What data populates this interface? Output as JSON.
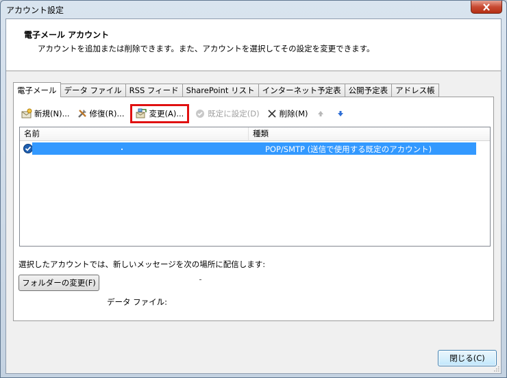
{
  "window": {
    "title": "アカウント設定"
  },
  "header": {
    "title": "電子メール アカウント",
    "description": "アカウントを追加または削除できます。また、アカウントを選択してその設定を変更できます。"
  },
  "tabs": [
    {
      "label": "電子メール",
      "active": true
    },
    {
      "label": "データ ファイル"
    },
    {
      "label": "RSS フィード"
    },
    {
      "label": "SharePoint リスト"
    },
    {
      "label": "インターネット予定表"
    },
    {
      "label": "公開予定表"
    },
    {
      "label": "アドレス帳"
    }
  ],
  "toolbar": {
    "new_label": "新規(N)...",
    "repair_label": "修復(R)...",
    "change_label": "変更(A)...",
    "set_default_label": "既定に設定(D)",
    "delete_label": "削除(M)"
  },
  "accounts_list": {
    "columns": [
      "名前",
      "種類"
    ],
    "rows": [
      {
        "name": "",
        "type": "POP/SMTP (送信で使用する既定のアカウント)",
        "selected": true
      }
    ]
  },
  "delivery": {
    "label": "選択したアカウントでは、新しいメッセージを次の場所に配信します:",
    "change_folder_label": "フォルダーの変更(F)",
    "data_file_label": "データ ファイル:"
  },
  "footer": {
    "close_label": "閉じる(C)"
  },
  "colors": {
    "selection": "#3399ff",
    "highlight_box": "#e01010",
    "title_close": "#c84a33"
  }
}
